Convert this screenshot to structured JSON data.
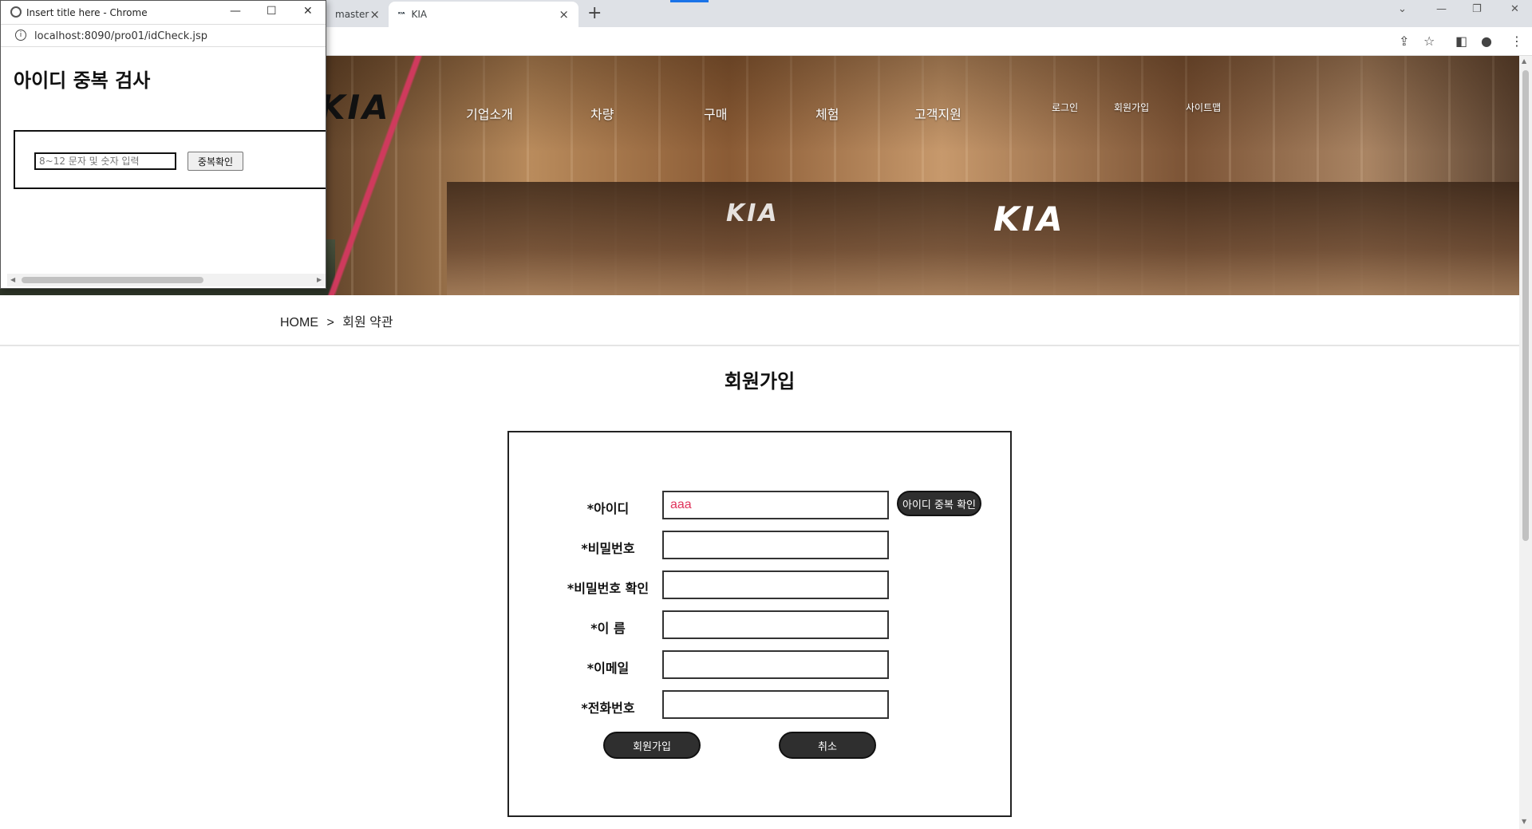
{
  "browser": {
    "tabs": [
      {
        "label": "master",
        "active": false
      },
      {
        "label": "KIA",
        "active": true
      }
    ],
    "new_tab": "+",
    "close_glyph": "×"
  },
  "popup": {
    "window_title": "Insert title here - Chrome",
    "url": "localhost:8090/pro01/idCheck.jsp",
    "heading": "아이디 중복 검사",
    "input_placeholder": "8~12 문자 및 숫자 입력",
    "check_button": "중복확인"
  },
  "header": {
    "logo": "KIA",
    "nav": [
      "기업소개",
      "차량",
      "구매",
      "체험",
      "고객지원"
    ],
    "util": [
      "로그인",
      "회원가입",
      "사이트맵"
    ]
  },
  "breadcrumb": {
    "home": "HOME",
    "separator": ">",
    "current": "회원 약관"
  },
  "page": {
    "title": "회원가입"
  },
  "form": {
    "fields": [
      {
        "label": "*아이디",
        "value": ""
      },
      {
        "label": "*비밀번호",
        "value": ""
      },
      {
        "label": "*비밀번호 확인",
        "value": ""
      },
      {
        "label": "*이 름",
        "value": ""
      },
      {
        "label": "*이메일",
        "value": ""
      },
      {
        "label": "*전화번호",
        "value": ""
      }
    ],
    "id_value": "aaa",
    "dup_check_button": "아이디 중복 확인",
    "submit_button": "회원가입",
    "cancel_button": "취소"
  },
  "colors": {
    "accent_red": "#e0335b",
    "button_dark": "#2f2f2f"
  }
}
